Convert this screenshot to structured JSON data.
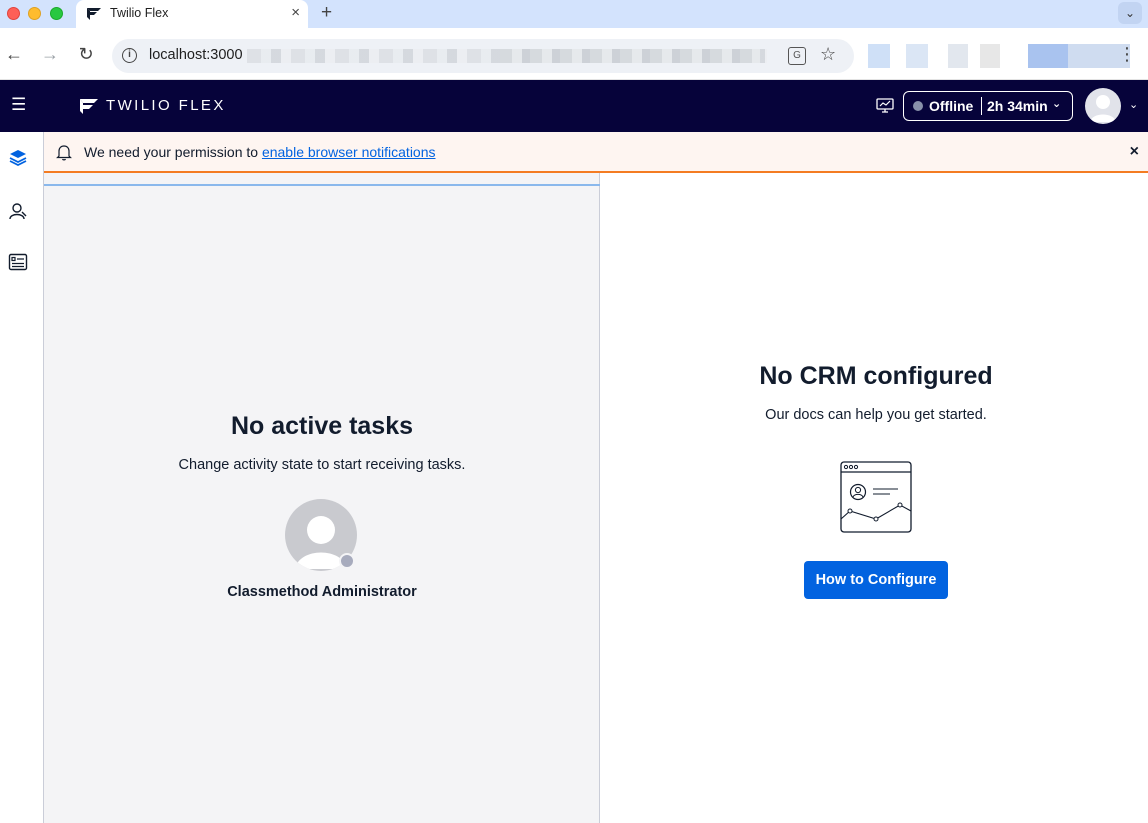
{
  "browser": {
    "tab_title": "Twilio Flex",
    "tab_close": "×",
    "new_tab": "+",
    "tabs_menu": "⌄",
    "back": "←",
    "forward": "→",
    "reload": "↻",
    "url": "localhost:3000",
    "info": "i",
    "translate": "G",
    "star": "☆",
    "menu": "⋮"
  },
  "header": {
    "menu_icon": "☰",
    "brand": "TWILIO FLEX",
    "status": "Offline",
    "timer": "2h 34min",
    "caret": "⌄",
    "user_caret": "⌄"
  },
  "notification": {
    "text": "We need your permission to ",
    "link": "enable browser notifications",
    "close": "×"
  },
  "tasks": {
    "title": "No active tasks",
    "subtitle": "Change activity state to start receiving tasks.",
    "agent_name": "Classmethod Administrator"
  },
  "crm": {
    "title": "No CRM configured",
    "subtitle": "Our docs can help you get started.",
    "button": "How to Configure"
  },
  "colors": {
    "header_bg": "#06033a",
    "accent": "#0263e0",
    "notice_border": "#f47c22",
    "panel_bg": "#f4f4f6"
  }
}
